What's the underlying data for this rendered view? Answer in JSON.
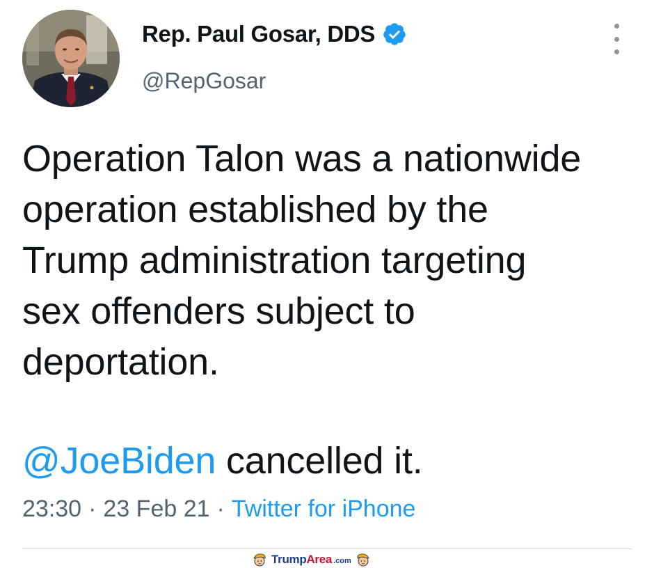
{
  "tweet": {
    "author": {
      "display_name": "Rep. Paul Gosar, DDS",
      "handle": "@RepGosar",
      "verified": true
    },
    "text_lines": [
      "Operation Talon was a nationwide",
      "operation established by the",
      "Trump administration targeting",
      "sex offenders subject to",
      "deportation."
    ],
    "reply": {
      "mention": "@JoeBiden",
      "text": " cancelled it."
    },
    "meta": {
      "time": "23:30",
      "separator": "·",
      "date": "23 Feb 21",
      "source": "Twitter for iPhone"
    }
  },
  "watermark": {
    "brand_part1": "Trump",
    "brand_part2": "Area",
    "suffix": ".com"
  },
  "colors": {
    "link_blue": "#1d9bf0",
    "text_dark": "#0f1419",
    "text_gray": "#536471",
    "verified_blue": "#1d9bf0"
  },
  "icons": {
    "verified": "verified-badge-icon",
    "more": "more-options-icon"
  }
}
